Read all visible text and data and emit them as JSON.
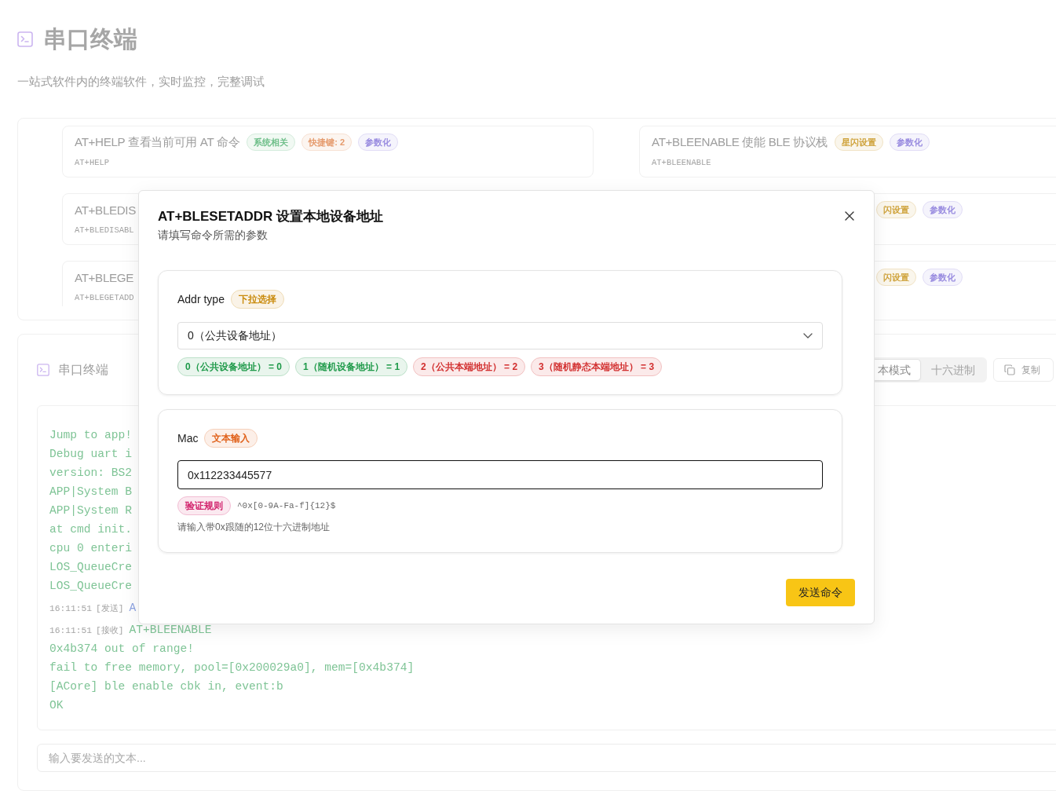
{
  "page": {
    "title": "串口终端",
    "subtitle": "一站式软件内的终端软件，实时监控，完整调试"
  },
  "commands": [
    {
      "title": "AT+HELP 查看当前可用 AT 命令",
      "tags": [
        {
          "text": "系统相关",
          "color": "#6fbf8a"
        },
        {
          "text": "快捷键: 2",
          "color": "#e59a6c"
        },
        {
          "text": "参数化",
          "color": "#9a8de0"
        }
      ],
      "command": "AT+HELP"
    },
    {
      "title": "AT+BLEENABLE 使能 BLE 协议栈",
      "tags": [
        {
          "text": "星闪设置",
          "color": "#cfa33c"
        },
        {
          "text": "参数化",
          "color": "#9a8de0"
        }
      ],
      "command": "AT+BLEENABLE"
    },
    {
      "title": "AT+BLEDIS",
      "command": "AT+BLEDISABL"
    },
    {
      "tags": [
        {
          "text": "闪设置",
          "color": "#cfa33c"
        },
        {
          "text": "参数化",
          "color": "#9a8de0"
        }
      ]
    },
    {
      "title": "AT+BLEGE",
      "command": "AT+BLEGETADD"
    },
    {
      "tags": [
        {
          "text": "闪设置",
          "color": "#cfa33c"
        },
        {
          "text": "参数化",
          "color": "#9a8de0"
        }
      ]
    }
  ],
  "terminal": {
    "title": "串口终端",
    "mode_tabs": [
      {
        "label": "本模式",
        "selected": true
      },
      {
        "label": "十六进制",
        "selected": false
      }
    ],
    "copy_button": "复制",
    "log": [
      {
        "kind": "output",
        "text": "Jump to app!"
      },
      {
        "kind": "output",
        "text": "Debug uart i"
      },
      {
        "kind": "output",
        "text": "version: BS2"
      },
      {
        "kind": "output",
        "text": "APP|System B"
      },
      {
        "kind": "output",
        "text": "APP|System R"
      },
      {
        "kind": "output",
        "text": "at cmd init."
      },
      {
        "kind": "output",
        "text": "cpu 0 enteri"
      },
      {
        "kind": "output",
        "text": "LOS_QueueCre"
      },
      {
        "kind": "output",
        "text": "LOS_QueueCre"
      },
      {
        "kind": "sent",
        "time": "16:11:51",
        "direction": "[发送]",
        "text": "A"
      },
      {
        "kind": "received",
        "time": "16:11:51",
        "direction": "[接收]",
        "text": "AT+BLEENABLE"
      },
      {
        "kind": "output",
        "text": "0x4b374 out of range!"
      },
      {
        "kind": "output",
        "text": "fail to free memory, pool=[0x200029a0], mem=[0x4b374]"
      },
      {
        "kind": "output",
        "text": "[ACore] ble enable cbk in, event:b"
      },
      {
        "kind": "output",
        "text": "OK"
      }
    ],
    "input": {
      "placeholder": "输入要发送的文本..."
    }
  },
  "modal": {
    "title": "AT+BLESETADDR 设置本地设备地址",
    "subtitle": "请填写命令所需的参数",
    "params": [
      {
        "kind": "select",
        "label": "Addr type",
        "badge": {
          "text": "下拉选择",
          "color": "#c98a0b"
        },
        "value": "0（公共设备地址）",
        "options": [
          {
            "text": "0（公共设备地址） = 0",
            "color": "#1f9a4a"
          },
          {
            "text": "1（随机设备地址） = 1",
            "color": "#1f9a4a"
          },
          {
            "text": "2（公共本端地址） = 2",
            "color": "#d22f2f"
          },
          {
            "text": "3（随机静态本端地址） = 3",
            "color": "#d22f2f"
          }
        ]
      },
      {
        "kind": "text",
        "label": "Mac",
        "badge": {
          "text": "文本输入",
          "color": "#e0611a"
        },
        "value": "0x112233445577",
        "focused": true,
        "rule_badge": {
          "text": "验证规则",
          "color": "#d2246d"
        },
        "rule": "^0x[0-9A-Fa-f]{12}$",
        "hint": "请输入带0x跟随的12位十六进制地址"
      }
    ],
    "submit": "发送命令"
  }
}
